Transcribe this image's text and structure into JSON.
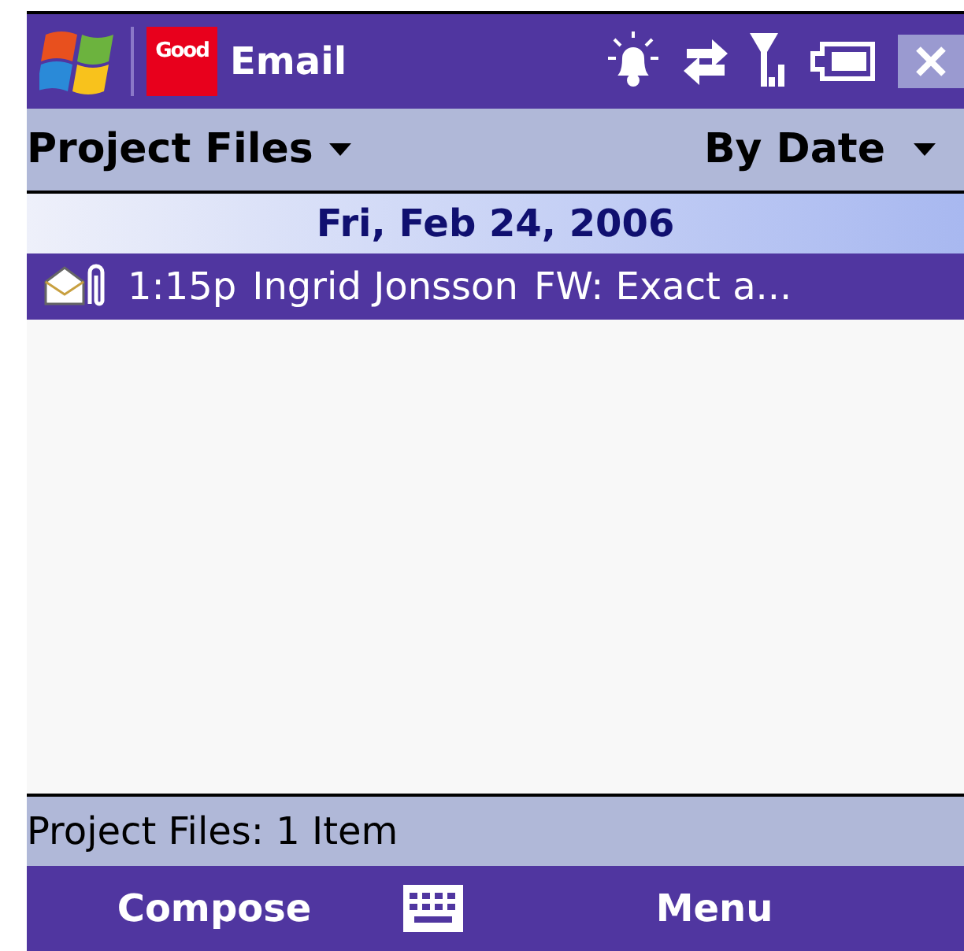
{
  "title_bar": {
    "app_badge": "Good",
    "title": "Email"
  },
  "header": {
    "folder": "Project Files",
    "sort": "By Date"
  },
  "groups": [
    {
      "date": "Fri, Feb 24, 2006",
      "messages": [
        {
          "time": "1:15p",
          "sender": "Ingrid Jonsson",
          "subject": "FW: Exact a...",
          "selected": true,
          "attachment": true
        }
      ]
    }
  ],
  "status_bar": "Project Files: 1 Item",
  "softkeys": {
    "left": "Compose",
    "right": "Menu"
  }
}
